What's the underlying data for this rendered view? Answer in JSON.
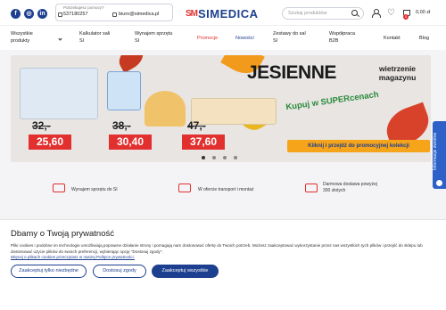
{
  "header": {
    "social": [
      "f",
      "◎",
      "in"
    ],
    "contact_help": "Potrzebujesz pomocy?",
    "phone": "537180257",
    "email": "biuro@simedica.pl",
    "logo_mark": "SM",
    "logo_text": "SIMEDICA",
    "search_placeholder": "Szukaj produktów",
    "cart_count": "0",
    "cart_total": "0,00 zł"
  },
  "nav": {
    "items": [
      {
        "label": "Wszystkie\nprodukty"
      },
      {
        "label": "Kalkulator sali\nSI"
      },
      {
        "label": "Wynajem sprzętu\nSI"
      },
      {
        "label": "Promocje"
      },
      {
        "label": "Nowości"
      },
      {
        "label": "Zestawy do sal\nSI"
      },
      {
        "label": "Współpraca\nB2B"
      },
      {
        "label": "Kontakt"
      },
      {
        "label": "Blog"
      }
    ]
  },
  "banner": {
    "headline": "JESIENNE",
    "subheadline": "wietrzenie magazynu",
    "tagline": "Kupuj w SUPERcenach",
    "cta": "Kliknij i przejdź do promocyjnej kolekcji",
    "prices": [
      {
        "old": "32,-",
        "new": "25,60"
      },
      {
        "old": "38,-",
        "new": "30,40"
      },
      {
        "old": "47,-",
        "new": "37,60"
      }
    ],
    "slide_count": 4,
    "active_slide": 1
  },
  "side_tab": {
    "label": "Informacje zwrotne"
  },
  "features": [
    {
      "label": "Wynajem sprzętu do SI",
      "icon": "handshake-icon"
    },
    {
      "label": "W ofercie transport i montaż",
      "icon": "truck-icon"
    },
    {
      "label": "Darmowa dostawa powyżej\n300 złotych",
      "icon": "package-icon"
    }
  ],
  "cookie": {
    "title": "Dbamy o Twoją prywatność",
    "text": "Pliki cookies i podobne im technologie umożliwiają poprawne działanie strony i pomagają nam dostosować ofertę do Twoich potrzeb. Możesz zaakceptować wykorzystanie przez nas wszystkich tych plików i przejść do sklepu lub dostosować użycie plików do swoich preferencji, wybierając opcję \"Dostosuj zgody\".",
    "link": "Więcej o plikach cookies przeczytasz w naszej Polityce prywatności.",
    "btn_required": "Zaakceptuj tylko niezbędne",
    "btn_customize": "Dostosuj zgody",
    "btn_all": "Zaakceptuj wszystkie"
  },
  "colors": {
    "brand_blue": "#1d3f8f",
    "brand_red": "#e2302f",
    "cta_orange": "#f6a51b"
  }
}
